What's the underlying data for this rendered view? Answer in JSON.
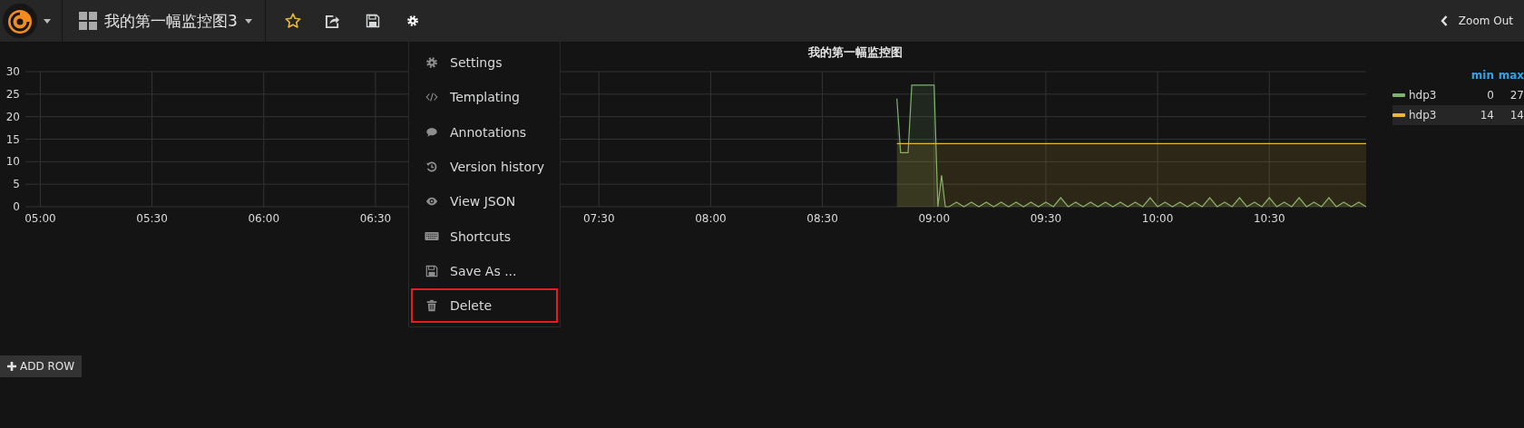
{
  "topbar": {
    "dashboard_title": "我的第一幅监控图3",
    "zoom_out": "Zoom Out"
  },
  "panel": {
    "title": "我的第一幅监控图",
    "chart_data": {
      "type": "area",
      "stacked": false,
      "grid": true,
      "xlim": [
        296,
        656
      ],
      "ylim": [
        0,
        30
      ],
      "yticks": [
        0,
        5,
        10,
        15,
        20,
        25,
        30
      ],
      "xticks": [
        {
          "value": 300,
          "label": "05:00"
        },
        {
          "value": 330,
          "label": "05:30"
        },
        {
          "value": 360,
          "label": "06:00"
        },
        {
          "value": 390,
          "label": "06:30"
        },
        {
          "value": 450,
          "label": "07:30"
        },
        {
          "value": 480,
          "label": "08:00"
        },
        {
          "value": 510,
          "label": "08:30"
        },
        {
          "value": 540,
          "label": "09:00"
        },
        {
          "value": 570,
          "label": "09:30"
        },
        {
          "value": 600,
          "label": "10:00"
        },
        {
          "value": 630,
          "label": "10:30"
        }
      ],
      "x": [
        530,
        531,
        533,
        534,
        540,
        541,
        542,
        543,
        544,
        546,
        548,
        550,
        552,
        554,
        556,
        558,
        560,
        562,
        564,
        566,
        568,
        570,
        572,
        574,
        576,
        578,
        580,
        582,
        584,
        586,
        588,
        590,
        592,
        594,
        596,
        598,
        600,
        602,
        604,
        606,
        608,
        610,
        612,
        614,
        616,
        618,
        620,
        622,
        624,
        626,
        628,
        630,
        632,
        634,
        636,
        638,
        640,
        642,
        644,
        646,
        648,
        650,
        652,
        654,
        656
      ],
      "series": [
        {
          "color": "#7eb26d",
          "values": [
            24,
            12,
            12,
            27,
            27,
            0,
            7,
            0,
            0,
            1,
            0,
            1,
            0,
            1,
            0,
            1,
            0,
            1,
            0,
            1,
            0,
            1,
            0,
            2,
            0,
            1,
            0,
            1,
            0,
            1,
            0,
            1,
            0,
            1,
            0,
            2,
            0,
            1,
            0,
            1,
            0,
            1,
            0,
            2,
            0,
            1,
            0,
            2,
            0,
            1,
            0,
            2,
            0,
            1,
            0,
            2,
            0,
            1,
            0,
            2,
            0,
            1,
            0,
            1,
            0
          ]
        },
        {
          "color": "#eab839",
          "values": [
            14,
            14,
            14,
            14,
            14,
            14,
            14,
            14,
            14,
            14,
            14,
            14,
            14,
            14,
            14,
            14,
            14,
            14,
            14,
            14,
            14,
            14,
            14,
            14,
            14,
            14,
            14,
            14,
            14,
            14,
            14,
            14,
            14,
            14,
            14,
            14,
            14,
            14,
            14,
            14,
            14,
            14,
            14,
            14,
            14,
            14,
            14,
            14,
            14,
            14,
            14,
            14,
            14,
            14,
            14,
            14,
            14,
            14,
            14,
            14,
            14,
            14,
            14,
            14,
            14
          ]
        }
      ]
    },
    "legend": {
      "columns": [
        "min",
        "max"
      ],
      "rows": [
        {
          "name": "hdp3",
          "color": "#7eb26d",
          "min": "0",
          "max": "27",
          "highlighted": false
        },
        {
          "name": "hdp3",
          "color": "#eab839",
          "min": "14",
          "max": "14",
          "highlighted": true
        }
      ]
    }
  },
  "settings_menu": {
    "items": [
      {
        "kind": "settings",
        "label": "Settings",
        "outlined": false
      },
      {
        "kind": "templating",
        "label": "Templating",
        "outlined": false
      },
      {
        "kind": "annotations",
        "label": "Annotations",
        "outlined": false
      },
      {
        "kind": "history",
        "label": "Version history",
        "outlined": false
      },
      {
        "kind": "json",
        "label": "View JSON",
        "outlined": false
      },
      {
        "kind": "shortcuts",
        "label": "Shortcuts",
        "outlined": false
      },
      {
        "kind": "save",
        "label": "Save As ...",
        "outlined": false
      },
      {
        "kind": "delete",
        "label": "Delete",
        "outlined": true
      }
    ]
  },
  "add_row_button": {
    "label": "ADD ROW"
  }
}
